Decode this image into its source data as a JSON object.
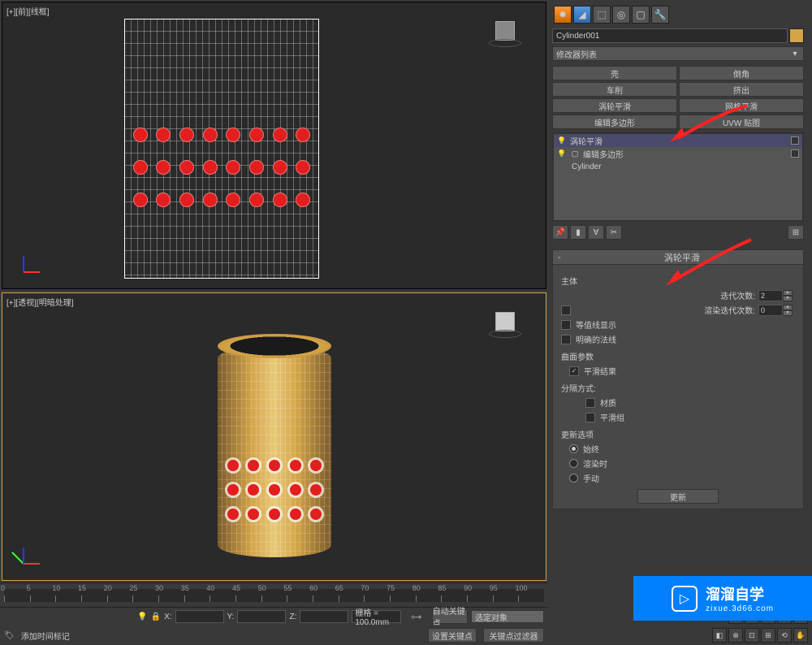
{
  "viewports": {
    "top_label": "[+][前][线框]",
    "bottom_label": "[+][透视][明暗处理]"
  },
  "object": {
    "name": "Cylinder001"
  },
  "modifier_list_label": "修改器列表",
  "modifier_buttons": {
    "shell": "壳",
    "chamfer": "倒角",
    "lathe": "车削",
    "extrude": "挤出",
    "turbosmooth": "涡轮平滑",
    "meshsmooth": "网格平滑",
    "editpoly": "编辑多边形",
    "uvwmap": "UVW 贴图"
  },
  "stack": {
    "item1": "涡轮平滑",
    "item2": "编辑多边形",
    "item3": "Cylinder"
  },
  "rollout": {
    "title": "涡轮平滑",
    "main_group": "主体",
    "iterations_label": "迭代次数:",
    "iterations_value": "2",
    "render_iter_label": "渲染迭代次数:",
    "render_iter_value": "0",
    "isoline_label": "等值线显示",
    "explicit_normals_label": "明确的法线",
    "surface_group": "曲面参数",
    "smooth_result": "平滑结果",
    "separate_label": "分隔方式:",
    "material": "材质",
    "smooth_group": "平滑组",
    "update_group": "更新选项",
    "always": "始终",
    "render": "渲染时",
    "manual": "手动",
    "update_btn": "更新"
  },
  "timeline": {
    "ticks": [
      "0",
      "5",
      "10",
      "15",
      "20",
      "25",
      "30",
      "35",
      "40",
      "45",
      "50",
      "55",
      "60",
      "65",
      "70",
      "75",
      "80",
      "85",
      "90",
      "95",
      "100"
    ]
  },
  "statusbar": {
    "x_label": "X:",
    "y_label": "Y:",
    "z_label": "Z:",
    "grid": "栅格 = 100.0mm",
    "autokey": "自动关键点",
    "selected": "选定对象",
    "add_time_tag": "添加时间标记",
    "set_key": "设置关键点",
    "key_filter": "关键点过滤器"
  },
  "watermark": {
    "main": "溜溜自学",
    "sub": "zixue.3d66.com"
  }
}
